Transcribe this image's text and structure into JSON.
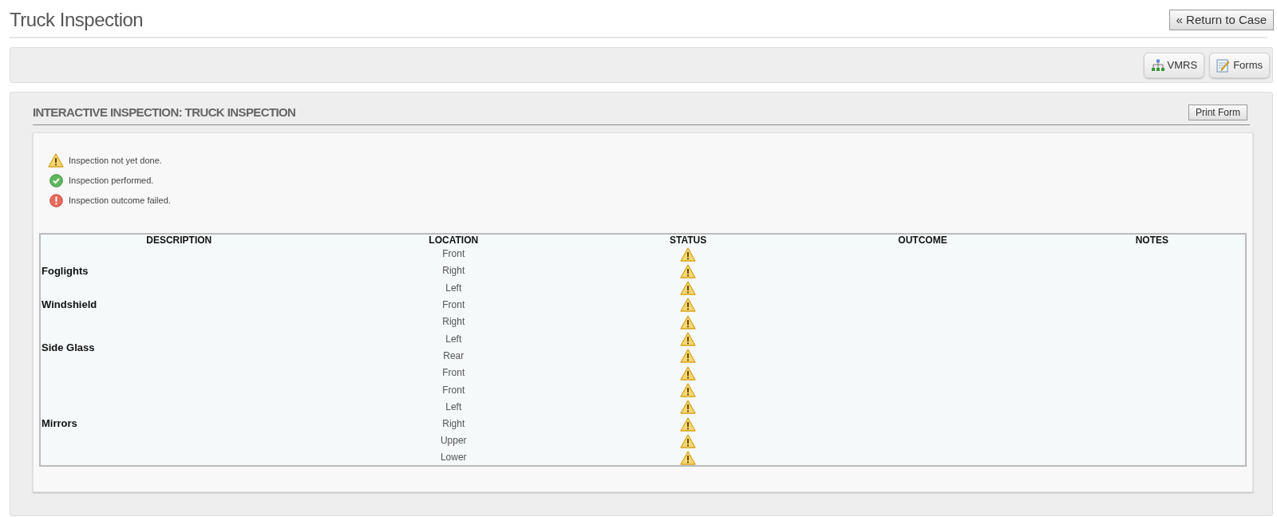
{
  "page": {
    "title": "Truck Inspection",
    "return_button": "« Return to Case"
  },
  "toolbar": {
    "buttons": [
      {
        "label": "VMRS"
      },
      {
        "label": "Forms"
      }
    ]
  },
  "form": {
    "heading": "INTERACTIVE INSPECTION: TRUCK INSPECTION",
    "print_button": "Print Form",
    "legend": [
      {
        "kind": "not_done",
        "label": "Inspection not yet done."
      },
      {
        "kind": "performed",
        "label": "Inspection performed."
      },
      {
        "kind": "failed",
        "label": "Inspection outcome failed."
      }
    ],
    "table": {
      "columns": [
        "DESCRIPTION",
        "LOCATION",
        "STATUS",
        "OUTCOME",
        "NOTES"
      ],
      "groups": [
        {
          "description": "Foglights",
          "rows": [
            {
              "location": "Front",
              "kind": "not_done"
            },
            {
              "location": "Right",
              "kind": "not_done"
            },
            {
              "location": "Left",
              "kind": "not_done"
            }
          ]
        },
        {
          "description": "Windshield",
          "rows": [
            {
              "location": "Front",
              "kind": "not_done"
            }
          ]
        },
        {
          "description": "Side Glass",
          "rows": [
            {
              "location": "Right",
              "kind": "not_done"
            },
            {
              "location": "Left",
              "kind": "not_done"
            },
            {
              "location": "Rear",
              "kind": "not_done"
            },
            {
              "location": "Front",
              "kind": "not_done"
            }
          ]
        },
        {
          "description": "Mirrors",
          "rows": [
            {
              "location": "Front",
              "kind": "not_done"
            },
            {
              "location": "Left",
              "kind": "not_done"
            },
            {
              "location": "Right",
              "kind": "not_done"
            },
            {
              "location": "Upper",
              "kind": "not_done"
            },
            {
              "location": "Lower",
              "kind": "not_done"
            }
          ]
        }
      ]
    }
  }
}
